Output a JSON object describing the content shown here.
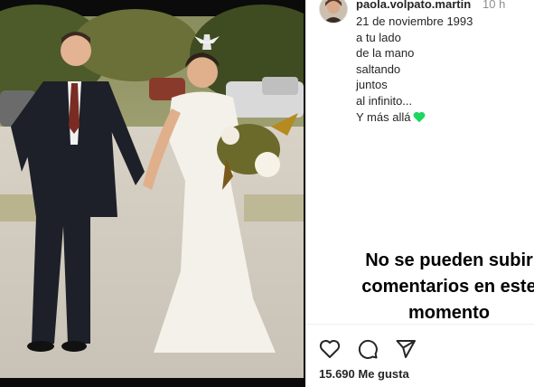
{
  "post": {
    "username": "paola.volpato.martin",
    "time_ago": "10 h",
    "caption_lines": [
      "21 de noviembre 1993",
      "a tu lado",
      "de la mano",
      "saltando",
      "juntos",
      "al infinito...",
      "Y más allá"
    ],
    "no_comments_text": "No se pueden subir comentarios en este momento",
    "likes": "15.690 Me gusta"
  },
  "icons": {
    "caption_emoji": "green-heart-icon",
    "like": "heart-icon",
    "comment": "comment-icon",
    "share": "send-icon"
  },
  "colors": {
    "emoji_green": "#1ed760",
    "text": "#262626",
    "muted": "#8e8e8e"
  }
}
